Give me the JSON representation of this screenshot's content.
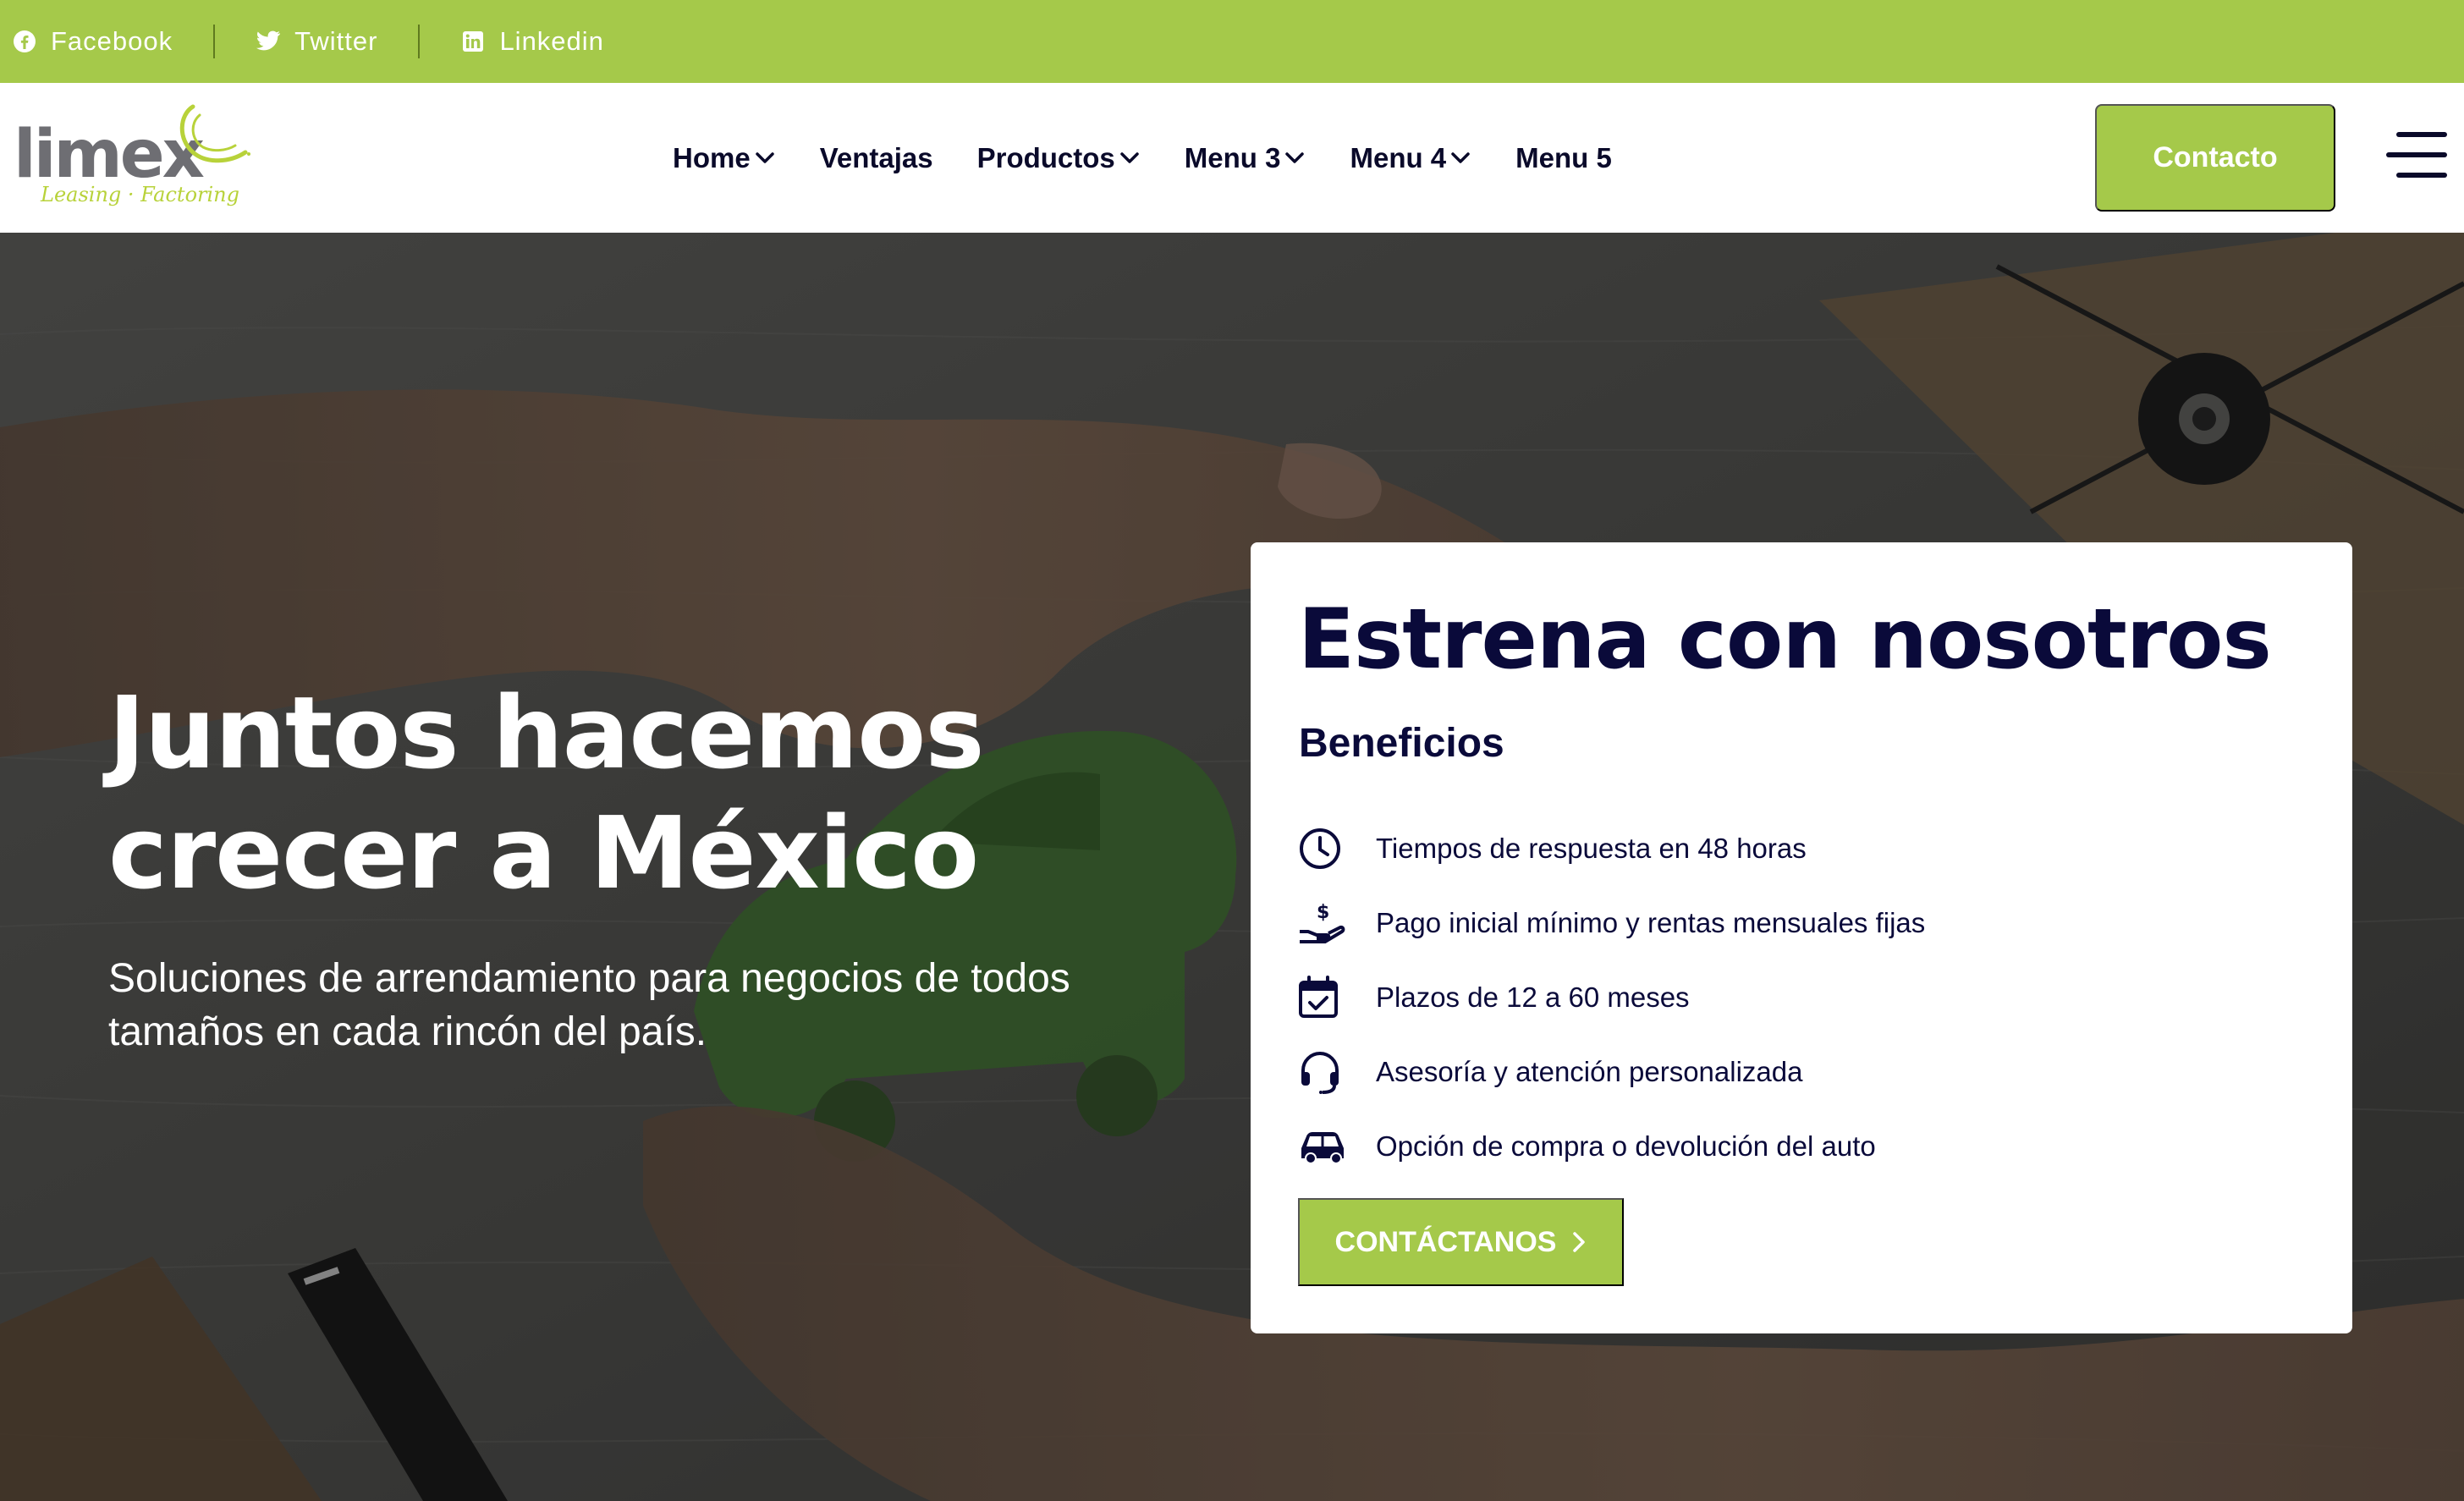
{
  "colors": {
    "brand_green": "#a5c94a",
    "navy": "#0a0a3a",
    "white": "#ffffff"
  },
  "topbar": {
    "links": [
      {
        "label": "Facebook",
        "icon": "facebook-icon"
      },
      {
        "label": "Twitter",
        "icon": "twitter-icon"
      },
      {
        "label": "Linkedin",
        "icon": "linkedin-icon"
      }
    ]
  },
  "header": {
    "logo": {
      "word": "limex",
      "tagline": "Leasing · Factoring"
    },
    "nav": [
      {
        "label": "Home",
        "has_dropdown": true
      },
      {
        "label": "Ventajas",
        "has_dropdown": false
      },
      {
        "label": "Productos",
        "has_dropdown": true
      },
      {
        "label": "Menu 3",
        "has_dropdown": true
      },
      {
        "label": "Menu 4",
        "has_dropdown": true
      },
      {
        "label": "Menu 5",
        "has_dropdown": false
      }
    ],
    "contact_label": "Contacto",
    "menu_icon": "hamburger-icon"
  },
  "hero": {
    "title_line1": "Juntos hacemos",
    "title_line2": "crecer a México",
    "subtitle": "Soluciones de arrendamiento para negocios de todos tamaños en cada rincón del país."
  },
  "card": {
    "title": "Estrena con nosotros",
    "subtitle": "Beneficios",
    "benefits": [
      {
        "text": "Tiempos de respuesta en 48 horas",
        "icon": "clock-icon"
      },
      {
        "text": "Pago inicial mínimo y rentas mensuales fijas",
        "icon": "hand-dollar-icon"
      },
      {
        "text": "Plazos de 12 a 60 meses",
        "icon": "calendar-check-icon"
      },
      {
        "text": "Asesoría y atención personalizada",
        "icon": "headset-icon"
      },
      {
        "text": "Opción de compra o devolución del auto",
        "icon": "car-icon"
      }
    ],
    "cta_label": "CONTÁCTANOS"
  }
}
